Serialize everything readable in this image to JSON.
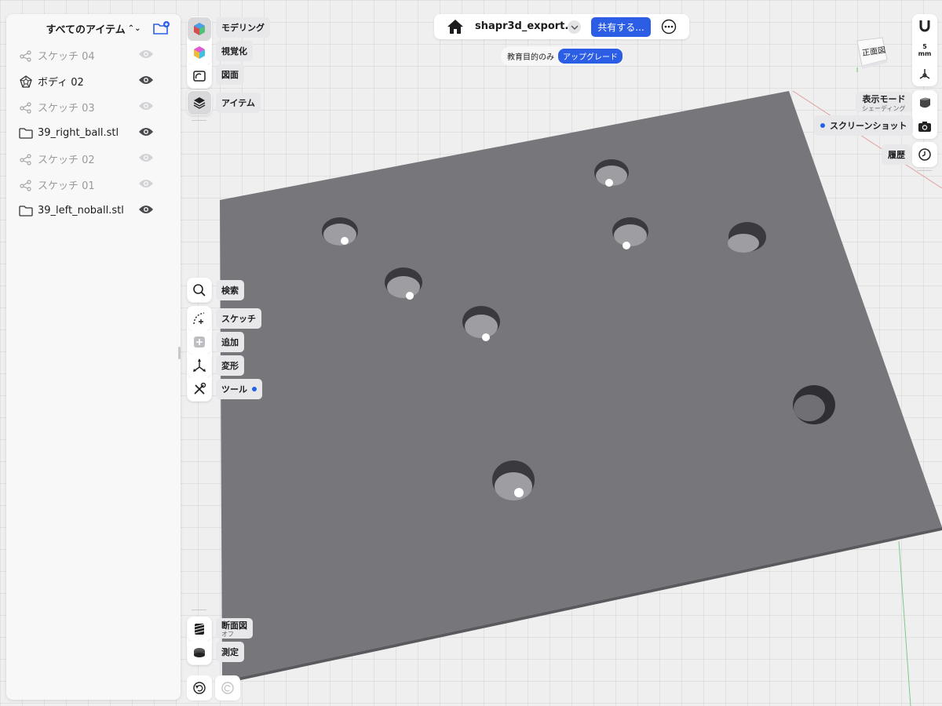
{
  "items_panel": {
    "header": "すべてのアイテム",
    "items": [
      {
        "label": "スケッチ 04",
        "type": "sketch",
        "icon": "sketch-icon",
        "visible": false
      },
      {
        "label": "ボディ 02",
        "type": "body",
        "icon": "body-icon",
        "visible": true
      },
      {
        "label": "スケッチ 03",
        "type": "sketch",
        "icon": "sketch-icon",
        "visible": false
      },
      {
        "label": "39_right_ball.stl",
        "type": "folder",
        "icon": "folder-icon",
        "visible": true
      },
      {
        "label": "スケッチ 02",
        "type": "sketch",
        "icon": "sketch-icon",
        "visible": false
      },
      {
        "label": "スケッチ 01",
        "type": "sketch",
        "icon": "sketch-icon",
        "visible": false
      },
      {
        "label": "39_left_noball.stl",
        "type": "folder",
        "icon": "folder-icon",
        "visible": true
      }
    ]
  },
  "workspace_tabs": {
    "modeling": "モデリング",
    "visualize": "視覚化",
    "drawing": "図面",
    "items": "アイテム"
  },
  "tools": {
    "search": "検索",
    "sketch": "スケッチ",
    "add": "追加",
    "transform": "変形",
    "tools": "ツール"
  },
  "bottom_tools": {
    "section": "断面図",
    "section_state": "オフ",
    "measure": "測定"
  },
  "top_bar": {
    "title": "shapr3d_export...",
    "share": "共有する...",
    "edu_label": "教育目的のみ",
    "upgrade": "アップグレード"
  },
  "right_panel": {
    "units_value": "5",
    "units": "mm",
    "view_cube_label": "正面図",
    "display_mode": "表示モード",
    "display_mode_value": "シェーディング",
    "screenshot": "スクリーンショット",
    "history": "履歴"
  },
  "colors": {
    "accent": "#2c5de5",
    "plate": "#76767a",
    "grid": "#efefef"
  }
}
